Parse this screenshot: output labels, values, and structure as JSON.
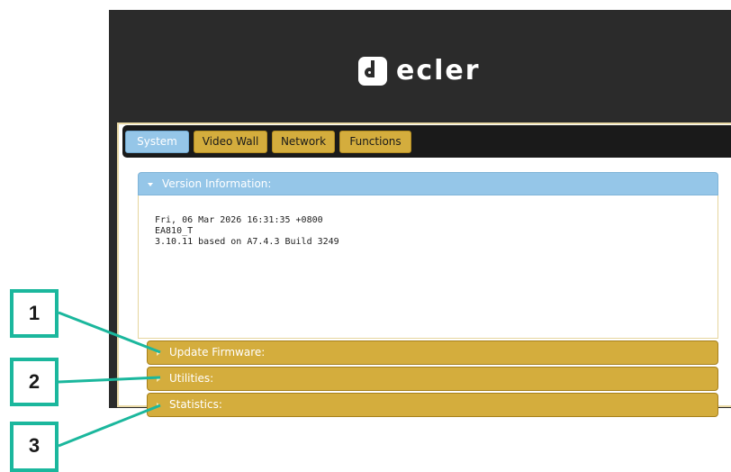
{
  "logo": {
    "text": "ecler"
  },
  "tabs": [
    {
      "label": "System",
      "active": true
    },
    {
      "label": "Video Wall",
      "active": false
    },
    {
      "label": "Network",
      "active": false
    },
    {
      "label": "Functions",
      "active": false
    }
  ],
  "version_section": {
    "title": "Version Information:",
    "lines": [
      "Fri, 06 Mar 2026 16:31:35 +0800",
      "EA810_T",
      "3.10.11 based on A7.4.3 Build 3249"
    ]
  },
  "sections": [
    {
      "title": "Update Firmware:"
    },
    {
      "title": "Utilities:"
    },
    {
      "title": "Statistics:"
    }
  ],
  "callouts": [
    "1",
    "2",
    "3"
  ],
  "colors": {
    "tab_active": "#95c6e8",
    "tab_inactive": "#d4ad3d",
    "callout": "#1bb79d",
    "header_bg": "#2b2b2b"
  }
}
